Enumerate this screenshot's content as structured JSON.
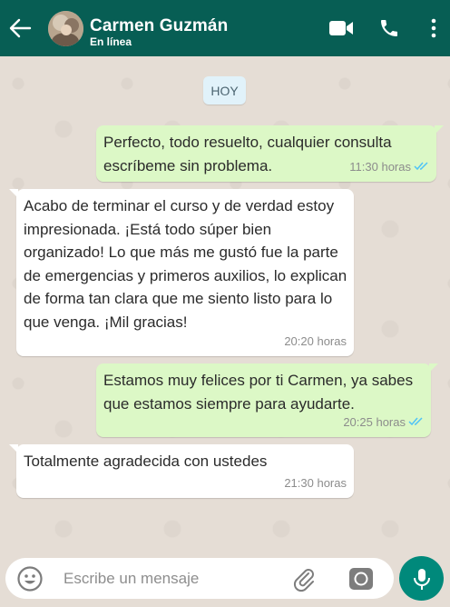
{
  "header": {
    "contact_name": "Carmen Guzmán",
    "status": "En línea",
    "bg_color": "#075e54"
  },
  "chat": {
    "day_label": "HOY",
    "messages": [
      {
        "direction": "outgoing",
        "text": "Perfecto, todo resuelto, cualquier consulta escríbeme sin problema.",
        "time": "11:30 horas",
        "read": true
      },
      {
        "direction": "incoming",
        "text": "Acabo de terminar el curso y de verdad estoy impresionada. ¡Está todo súper bien organizado! Lo que más me gustó fue la parte de emergencias y primeros auxilios, lo explican de forma tan clara que me siento listo para lo que venga. ¡Mil gracias!",
        "time": "20:20 horas"
      },
      {
        "direction": "outgoing",
        "text": "Estamos muy felices por ti Carmen, ya sabes que estamos siempre para ayudarte.",
        "time": "20:25 horas",
        "read": true
      },
      {
        "direction": "incoming",
        "text": "Totalmente agradecida con ustedes",
        "time": "21:30 horas"
      }
    ]
  },
  "composer": {
    "placeholder": "Escribe un mensaje"
  },
  "icons": [
    "back-arrow-icon",
    "video-call-icon",
    "phone-icon",
    "more-vertical-icon",
    "emoji-icon",
    "attach-clip-icon",
    "camera-icon",
    "mic-icon",
    "double-check-icon"
  ],
  "colors": {
    "outgoing_bubble": "#dcf8c6",
    "incoming_bubble": "#ffffff",
    "accent": "#00897b",
    "read_check": "#4fc3f7"
  }
}
